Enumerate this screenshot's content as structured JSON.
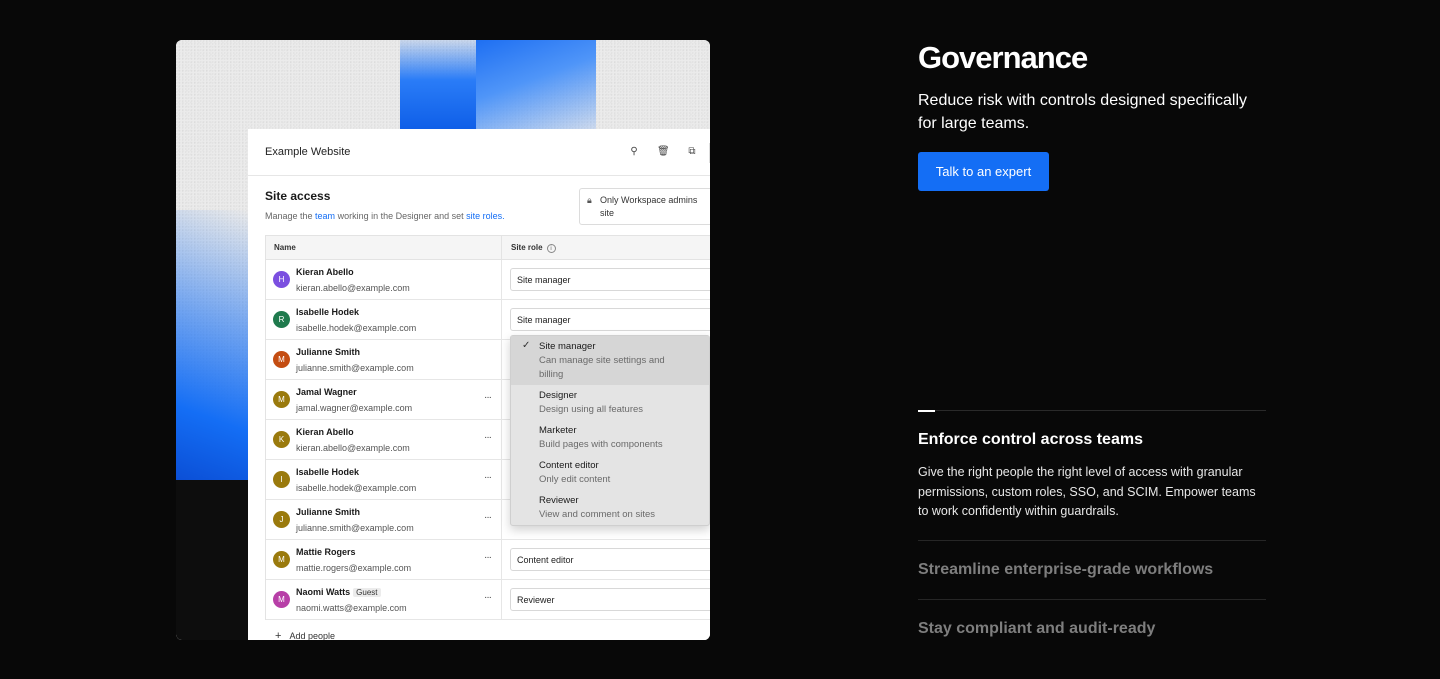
{
  "product_preview": {
    "app_title": "Example Website",
    "site_access": {
      "title": "Site access",
      "sub_prefix": "Manage the ",
      "sub_link_team": "team",
      "sub_middle": " working in the Designer and set ",
      "sub_link_roles": "site roles.",
      "admin_notice_line1": "Only Workspace admins",
      "admin_notice_line2": "site"
    },
    "table": {
      "col_name": "Name",
      "col_role": "Site role",
      "rows": [
        {
          "initial": "H",
          "avatar_color": "#7b4fe0",
          "name": "Kieran Abello",
          "email": "kieran.abello@example.com",
          "role": "Site manager",
          "menu": ""
        },
        {
          "initial": "R",
          "avatar_color": "#1f7a4d",
          "name": "Isabelle Hodek",
          "email": "isabelle.hodek@example.com",
          "role": "Site manager",
          "menu": ""
        },
        {
          "initial": "M",
          "avatar_color": "#c44d12",
          "name": "Julianne Smith",
          "email": "julianne.smith@example.com",
          "role": "",
          "menu": ""
        },
        {
          "initial": "M",
          "avatar_color": "#9a7a0d",
          "name": "Jamal Wagner",
          "email": "jamal.wagner@example.com",
          "role": "",
          "menu": "···"
        },
        {
          "initial": "K",
          "avatar_color": "#9a7a0d",
          "name": "Kieran Abello",
          "email": "kieran.abello@example.com",
          "role": "",
          "menu": "···"
        },
        {
          "initial": "I",
          "avatar_color": "#9a7a0d",
          "name": "Isabelle Hodek",
          "email": "isabelle.hodek@example.com",
          "role": "",
          "menu": "···"
        },
        {
          "initial": "J",
          "avatar_color": "#9a7a0d",
          "name": "Julianne Smith",
          "email": "julianne.smith@example.com",
          "role": "",
          "menu": "···"
        },
        {
          "initial": "M",
          "avatar_color": "#9a7a0d",
          "name": "Mattie Rogers",
          "email": "mattie.rogers@example.com",
          "role": "Content editor",
          "menu": "···"
        },
        {
          "initial": "M",
          "avatar_color": "#b73fa7",
          "name": "Naomi Watts",
          "guest": "Guest",
          "email": "naomi.watts@example.com",
          "role": "Reviewer",
          "menu": "···"
        }
      ]
    },
    "role_menu": [
      {
        "label": "Site manager",
        "desc_line1": "Can manage site settings and",
        "desc_line2": "billing",
        "selected": true
      },
      {
        "label": "Designer",
        "desc_line1": "Design using all features",
        "desc_line2": "",
        "selected": false
      },
      {
        "label": "Marketer",
        "desc_line1": "Build pages with components",
        "desc_line2": "",
        "selected": false
      },
      {
        "label": "Content editor",
        "desc_line1": "Only edit content",
        "desc_line2": "",
        "selected": false
      },
      {
        "label": "Reviewer",
        "desc_line1": "View and comment on sites",
        "desc_line2": "",
        "selected": false
      }
    ],
    "add_people": "Add people"
  },
  "governance": {
    "title": "Governance",
    "subtitle": "Reduce risk with controls designed specifically for large teams.",
    "cta": "Talk to an expert",
    "accent_color": "#146ef5",
    "active_progress": 0.05,
    "features": [
      {
        "title": "Enforce control across teams",
        "description": "Give the right people the right level of access with granular permissions, custom roles, SSO, and SCIM. Empower teams to work confidently within guardrails."
      },
      {
        "title": "Streamline enterprise-grade workflows"
      },
      {
        "title": "Stay compliant and audit-ready"
      }
    ]
  }
}
